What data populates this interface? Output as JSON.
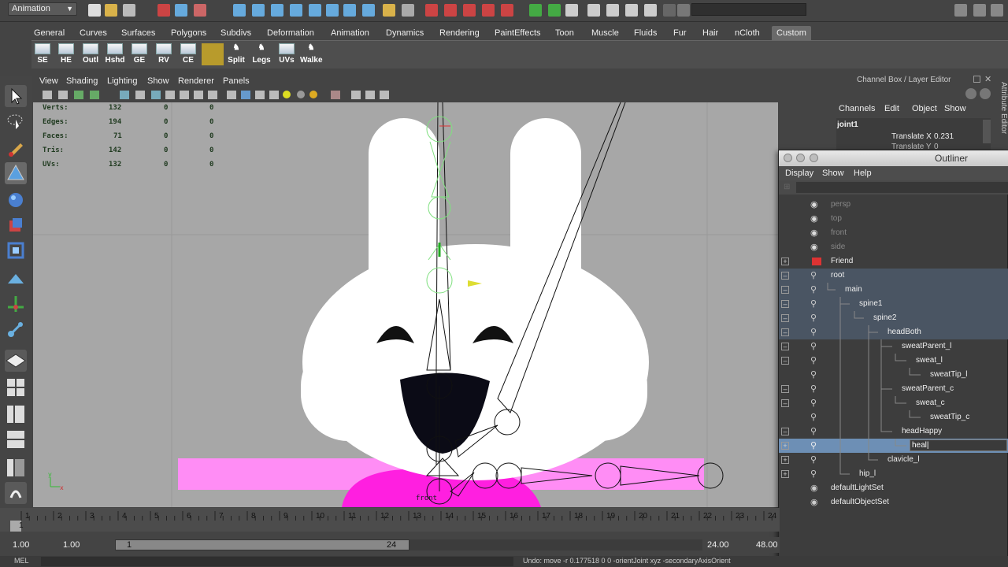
{
  "statusline": {
    "mode": "Animation"
  },
  "shelf": {
    "tabs": [
      "General",
      "Curves",
      "Surfaces",
      "Polygons",
      "Subdivs",
      "Deformation",
      "Animation",
      "Dynamics",
      "Rendering",
      "PaintEffects",
      "Toon",
      "Muscle",
      "Fluids",
      "Fur",
      "Hair",
      "nCloth",
      "Custom"
    ],
    "active_tab": "Custom",
    "buttons": [
      "SE",
      "HE",
      "Outl",
      "Hshd",
      "GE",
      "RV",
      "CE",
      "",
      "Split",
      "Legs",
      "UVs",
      "Walke"
    ]
  },
  "viewport": {
    "menu": [
      "View",
      "Shading",
      "Lighting",
      "Show",
      "Renderer",
      "Panels"
    ],
    "hud": {
      "rows": [
        {
          "label": "Verts:",
          "v1": "132",
          "v2": "0",
          "v3": "0"
        },
        {
          "label": "Edges:",
          "v1": "194",
          "v2": "0",
          "v3": "0"
        },
        {
          "label": "Faces:",
          "v1": "71",
          "v2": "0",
          "v3": "0"
        },
        {
          "label": "Tris:",
          "v1": "142",
          "v2": "0",
          "v3": "0"
        },
        {
          "label": "UVs:",
          "v1": "132",
          "v2": "0",
          "v3": "0"
        }
      ]
    },
    "camera_label": "front",
    "colors": {
      "background": "#a7a7a7",
      "pink": "#ff8df5",
      "magenta": "#ff1fe0"
    }
  },
  "channelbox": {
    "title": "Channel Box / Layer Editor",
    "menu": [
      "Channels",
      "Edit",
      "Object",
      "Show"
    ],
    "object": "joint1",
    "attr_label": "Translate X",
    "attr_value": "0.231",
    "attr2_label": "Translate Y",
    "attr2_value": "0",
    "side_tab": "Attribute Editor"
  },
  "outliner": {
    "title": "Outliner",
    "menu": [
      "Display",
      "Show",
      "Help"
    ],
    "items": [
      {
        "label": "persp",
        "dim": true
      },
      {
        "label": "top",
        "dim": true
      },
      {
        "label": "front",
        "dim": true
      },
      {
        "label": "side",
        "dim": true
      },
      {
        "label": "Friend"
      },
      {
        "label": "root"
      },
      {
        "label": "main"
      },
      {
        "label": "spine1"
      },
      {
        "label": "spine2"
      },
      {
        "label": "headBoth"
      },
      {
        "label": "sweatParent_l"
      },
      {
        "label": "sweat_l"
      },
      {
        "label": "sweatTip_l"
      },
      {
        "label": "sweatParent_c"
      },
      {
        "label": "sweat_c"
      },
      {
        "label": "sweatTip_c"
      },
      {
        "label": "headHappy"
      },
      {
        "label": "heal|"
      },
      {
        "label": "clavicle_l"
      },
      {
        "label": "hip_l"
      },
      {
        "label": "defaultLightSet"
      },
      {
        "label": "defaultObjectSet"
      }
    ]
  },
  "timeline": {
    "ticks": [
      "1",
      "2",
      "3",
      "4",
      "5",
      "6",
      "7",
      "8",
      "9",
      "10",
      "11",
      "12",
      "13",
      "14",
      "15",
      "16",
      "17",
      "18",
      "19",
      "20",
      "21",
      "22",
      "23",
      "24"
    ],
    "current": "1"
  },
  "range": {
    "start": "1.00",
    "start2": "1.00",
    "slider_start": "1",
    "slider_end": "24",
    "end": "24.00",
    "end2": "48.00"
  },
  "helpline": {
    "left": "MEL",
    "right": "Undo: move -r 0.177518 0 0 -orientJoint xyz -secondaryAxisOrient"
  }
}
